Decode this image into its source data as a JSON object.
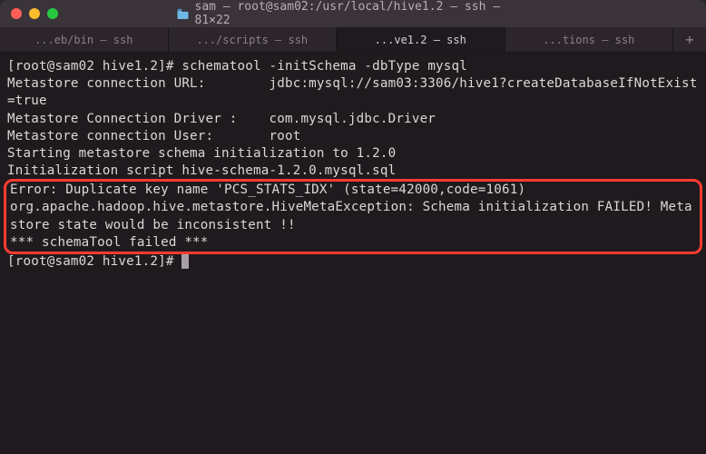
{
  "window": {
    "title": "sam — root@sam02:/usr/local/hive1.2 — ssh — 81×22"
  },
  "tabs": {
    "t0": "...eb/bin — ssh",
    "t1": ".../scripts — ssh",
    "t2": "...ve1.2 — ssh",
    "t3": "...tions — ssh",
    "new": "+"
  },
  "terminal": {
    "prompt1": "[root@sam02 hive1.2]# ",
    "cmd1": "schematool -initSchema -dbType mysql",
    "line_url": "Metastore connection URL:        jdbc:mysql://sam03:3306/hive1?createDatabaseIfNotExist=true",
    "line_driver": "Metastore Connection Driver :    com.mysql.jdbc.Driver",
    "line_user": "Metastore connection User:       root",
    "line_start": "Starting metastore schema initialization to 1.2.0",
    "line_script": "Initialization script hive-schema-1.2.0.mysql.sql",
    "err1": "Error: Duplicate key name 'PCS_STATS_IDX' (state=42000,code=1061)",
    "err2": "org.apache.hadoop.hive.metastore.HiveMetaException: Schema initialization FAILED! Metastore state would be inconsistent !!",
    "err3": "*** schemaTool failed ***",
    "prompt2": "[root@sam02 hive1.2]# "
  }
}
